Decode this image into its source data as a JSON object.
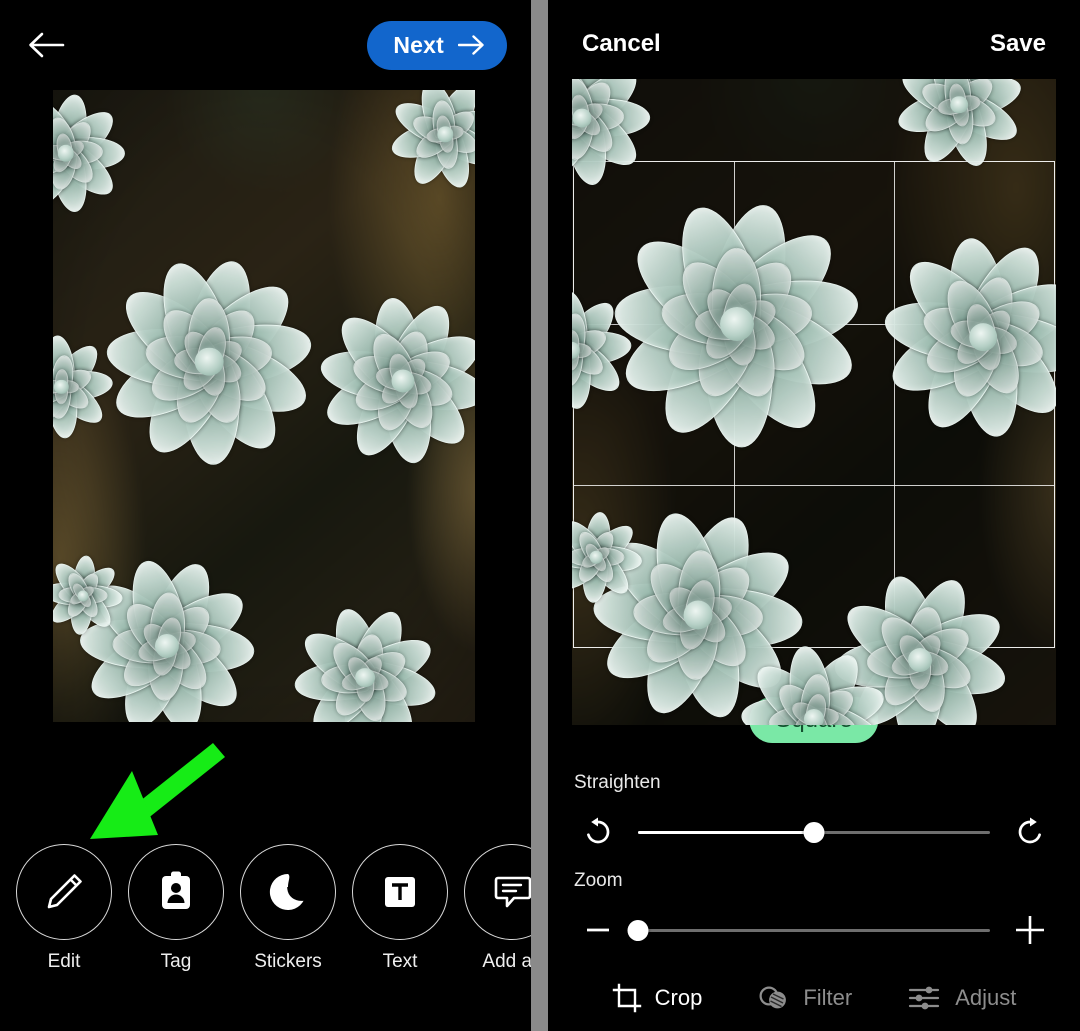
{
  "left_panel": {
    "back_icon": "arrow-left-icon",
    "next_button": {
      "label": "Next",
      "icon": "arrow-right-icon",
      "color": "#1266cc"
    },
    "photo": {
      "alt": "close-up photograph of pale green succulent rosettes"
    },
    "annotation": {
      "type": "arrow",
      "color": "#16ec16",
      "points_to": "Edit"
    },
    "tools": [
      {
        "label": "Edit",
        "icon": "pencil-icon"
      },
      {
        "label": "Tag",
        "icon": "tag-person-icon"
      },
      {
        "label": "Stickers",
        "icon": "sticker-icon"
      },
      {
        "label": "Text",
        "icon": "text-box-icon"
      },
      {
        "label": "Add alt",
        "icon": "alt-text-bubble-icon"
      }
    ]
  },
  "right_panel": {
    "topbar": {
      "cancel_label": "Cancel",
      "save_label": "Save"
    },
    "crop": {
      "grid": "rule-of-thirds",
      "ratio_pill": {
        "label": "Square",
        "bg_color": "#7ae8a6",
        "text_color": "#13502f"
      }
    },
    "straighten": {
      "label": "Straighten",
      "rotate_left_icon": "rotate-counterclockwise-icon",
      "rotate_right_icon": "rotate-clockwise-icon",
      "value_percent": 50
    },
    "zoom": {
      "label": "Zoom",
      "minus_icon": "minus-icon",
      "plus_icon": "plus-icon",
      "value_percent": 0
    },
    "tabs": [
      {
        "label": "Crop",
        "icon": "crop-icon",
        "active": true
      },
      {
        "label": "Filter",
        "icon": "filter-icon",
        "active": false
      },
      {
        "label": "Adjust",
        "icon": "sliders-icon",
        "active": false
      }
    ]
  }
}
